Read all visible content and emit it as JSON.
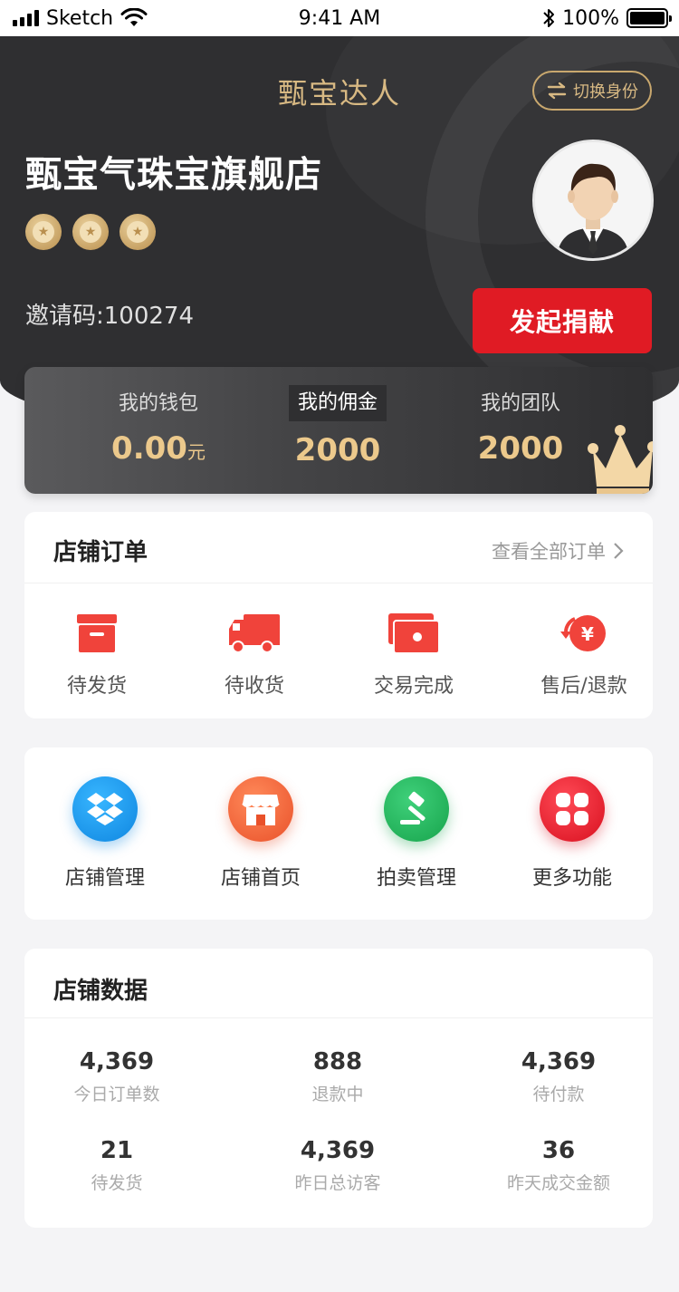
{
  "status_bar": {
    "carrier": "Sketch",
    "time": "9:41 AM",
    "battery": "100%"
  },
  "header": {
    "title": "甄宝达人",
    "switch_label": "切换身份",
    "store_name": "甄宝气珠宝旗舰店",
    "medal_count": 3,
    "invite_code": "邀请码:100274",
    "donate_label": "发起捐献"
  },
  "stats": {
    "wallet": {
      "label": "我的钱包",
      "value": "0.00",
      "unit": "元"
    },
    "commission": {
      "label": "我的佣金",
      "value": "2000"
    },
    "team": {
      "label": "我的团队",
      "value": "2000"
    }
  },
  "orders": {
    "title": "店铺订单",
    "view_all": "查看全部订单",
    "items": [
      {
        "label": "待发货",
        "icon": "box-icon"
      },
      {
        "label": "待收货",
        "icon": "truck-icon"
      },
      {
        "label": "交易完成",
        "icon": "wallet-icon"
      },
      {
        "label": "售后/退款",
        "icon": "refund-icon"
      }
    ]
  },
  "functions": {
    "items": [
      {
        "label": "店铺管理",
        "icon": "dropbox-icon",
        "color": "#1e9bf0"
      },
      {
        "label": "店铺首页",
        "icon": "storefront-icon",
        "color": "#f0653a"
      },
      {
        "label": "拍卖管理",
        "icon": "gavel-icon",
        "color": "#22b258"
      },
      {
        "label": "更多功能",
        "icon": "grid-icon",
        "color": "#e8192c"
      }
    ]
  },
  "store_data": {
    "title": "店铺数据",
    "cells": [
      {
        "value": "4,369",
        "label": "今日订单数"
      },
      {
        "value": "888",
        "label": "退款中"
      },
      {
        "value": "4,369",
        "label": "待付款"
      },
      {
        "value": "21",
        "label": "待发货"
      },
      {
        "value": "4,369",
        "label": "昨日总访客"
      },
      {
        "value": "36",
        "label": "昨天成交金额"
      }
    ]
  },
  "colors": {
    "gold": "#d8b983",
    "dark_bg": "#2f2f31",
    "accent_red": "#e01b24",
    "order_icon_red": "#f0433b"
  }
}
